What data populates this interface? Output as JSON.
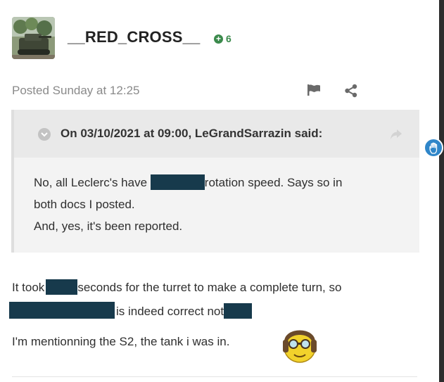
{
  "author": {
    "username": "__RED_CROSS__",
    "reputation": "6",
    "avatar_icon": "tank-avatar-icon"
  },
  "post_meta": {
    "posted": "Posted Sunday at 12:25"
  },
  "actions": {
    "report_icon": "flag-icon",
    "share_icon": "share-icon"
  },
  "quote": {
    "citation": "On 03/10/2021 at 09:00, LeGrandSarrazin said:",
    "line1_a": "No, all Leclerc's have",
    "line1_b": "rotation speed. Says so in",
    "line2": "both docs I posted.",
    "line3": "And, yes, it's been reported."
  },
  "content": {
    "line1_a": "It took",
    "line1_b": "seconds for the turret to make a complete turn, so",
    "line2_b": "is indeed correct not",
    "line3": "I'm mentionning the S2, the tank i was in."
  },
  "colors": {
    "redaction": "#173a4c",
    "reputation": "#3b8a4c",
    "accent": "#2f86c9"
  }
}
